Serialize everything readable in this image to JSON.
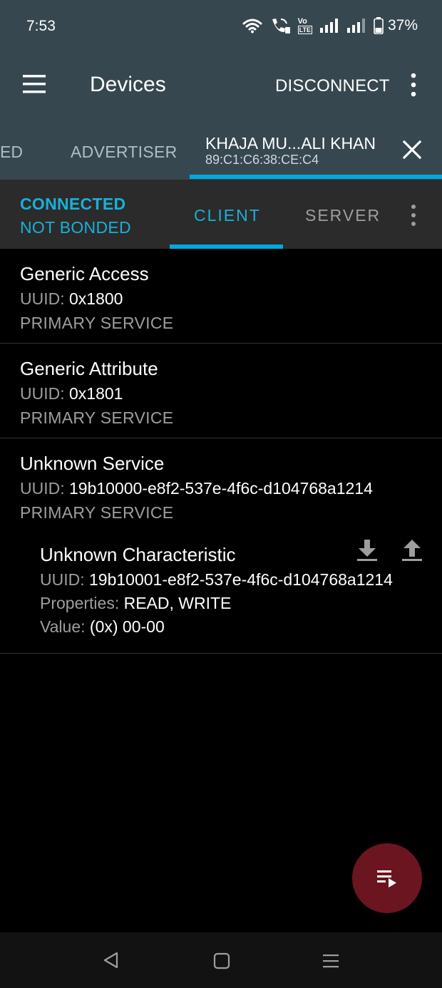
{
  "status_bar": {
    "time": "7:53",
    "battery": "37%",
    "icons": [
      "wifi-icon",
      "wifi-calling-icon",
      "volte-icon",
      "signal-icon",
      "signal-icon-2",
      "battery-icon"
    ],
    "volte_top": "Vo",
    "volte_bottom": "LTE"
  },
  "app_bar": {
    "title": "Devices",
    "disconnect_label": "DISCONNECT"
  },
  "device_tabs": {
    "partial_tab": "ED",
    "advertiser_tab": "ADVERTISER",
    "device_name": "KHAJA MU...ALI KHAN",
    "device_address": "89:C1:C6:38:CE:C4"
  },
  "sub_bar": {
    "connection_state": "CONNECTED",
    "bond_state": "NOT BONDED",
    "client_tab": "CLIENT",
    "server_tab": "SERVER"
  },
  "services": [
    {
      "name": "Generic Access",
      "uuid_label": "UUID:",
      "uuid": "0x1800",
      "type": "PRIMARY SERVICE"
    },
    {
      "name": "Generic Attribute",
      "uuid_label": "UUID:",
      "uuid": "0x1801",
      "type": "PRIMARY SERVICE"
    },
    {
      "name": "Unknown Service",
      "uuid_label": "UUID:",
      "uuid": "19b10000-e8f2-537e-4f6c-d104768a1214",
      "type": "PRIMARY SERVICE",
      "characteristic": {
        "name": "Unknown Characteristic",
        "uuid_label": "UUID:",
        "uuid": "19b10001-e8f2-537e-4f6c-d104768a1214",
        "properties_label": "Properties:",
        "properties": "READ, WRITE",
        "value_label": "Value:",
        "value": "(0x) 00-00"
      }
    }
  ],
  "colors": {
    "app_bar": "#37474f",
    "accent": "#00a9e0",
    "fab": "#6b1520"
  }
}
